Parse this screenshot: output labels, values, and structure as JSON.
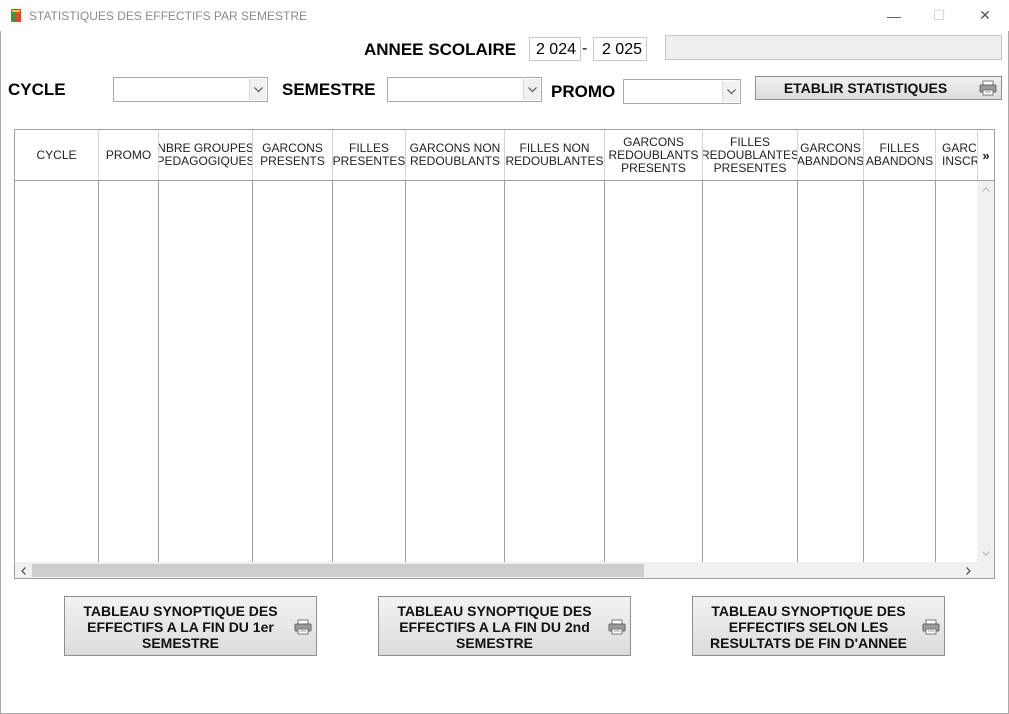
{
  "window": {
    "title": "STATISTIQUES DES EFFECTIFS PAR SEMESTRE",
    "minimize_symbol": "—",
    "maximize_symbol": "☐",
    "close_symbol": "✕"
  },
  "annee_scolaire": {
    "label": "ANNEE SCOLAIRE",
    "start_year": "2 024",
    "separator": "-",
    "end_year": "2 025"
  },
  "filters": {
    "cycle_label": "CYCLE",
    "cycle_value": "",
    "semestre_label": "SEMESTRE",
    "semestre_value": "",
    "promo_label": "PROMO",
    "promo_value": ""
  },
  "actions": {
    "etablir_label": "ETABLIR STATISTIQUES"
  },
  "table": {
    "columns": [
      "CYCLE",
      "PROMO",
      "NBRE GROUPES PEDAGOGIQUES",
      "GARCONS PRESENTS",
      "FILLES PRESENTES",
      "GARCONS NON REDOUBLANTS",
      "FILLES NON REDOUBLANTES",
      "GARCONS REDOUBLANTS PRESENTS",
      "FILLES REDOUBLANTES PRESENTES",
      "GARCONS ABANDONS",
      "FILLES ABANDONS",
      "GARCONS INSCRITS"
    ],
    "more_columns_symbol": "»",
    "rows": []
  },
  "reports": {
    "btn1_label": "TABLEAU SYNOPTIQUE DES EFFECTIFS A LA FIN DU 1er SEMESTRE",
    "btn2_label": "TABLEAU SYNOPTIQUE DES EFFECTIFS A LA FIN DU 2nd SEMESTRE",
    "btn3_label": "TABLEAU SYNOPTIQUE DES EFFECTIFS SELON LES RESULTATS DE FIN D'ANNEE"
  },
  "icons": {
    "app": "app-icon",
    "printer": "printer-icon",
    "dropdown": "chevron-down-icon"
  },
  "colors": {
    "title_text": "#8a8a8a",
    "button_face": "#e4e4e4",
    "grid_line": "#a0a0a0",
    "accent": "#3b8fd6"
  }
}
